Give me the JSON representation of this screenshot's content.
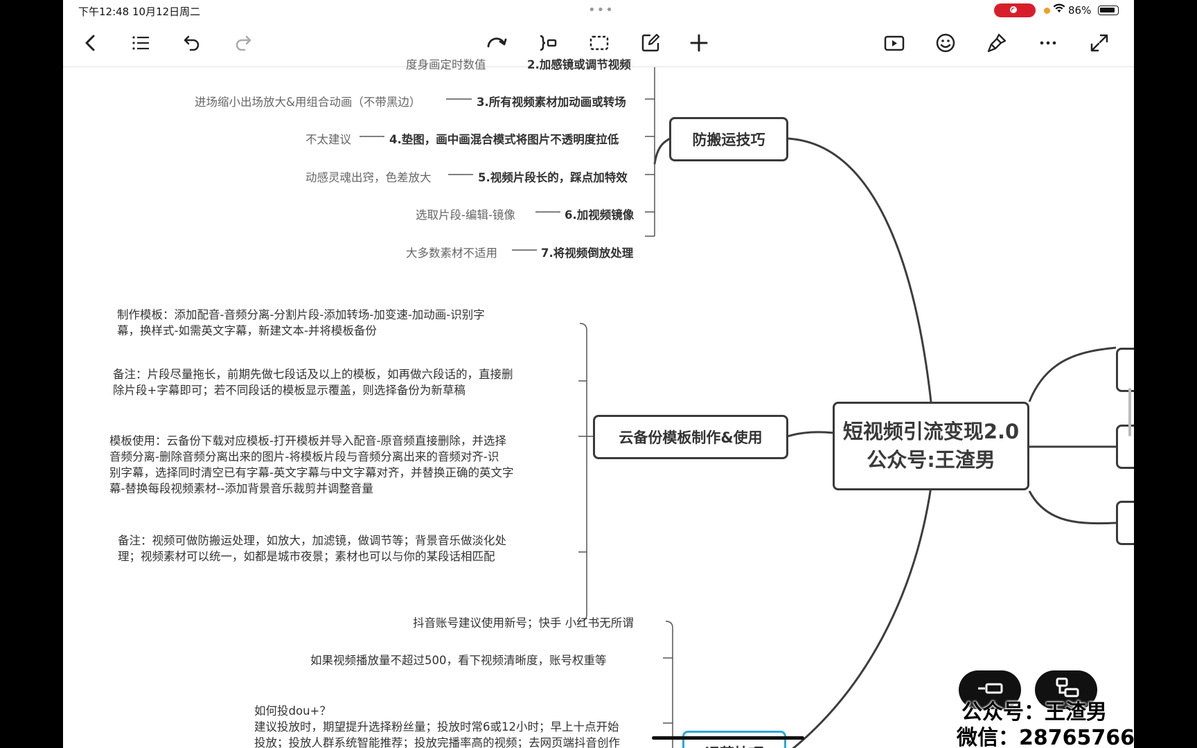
{
  "status_bar": {
    "time": "下午12:48   10月12日周二",
    "battery": "86%"
  },
  "mindmap": {
    "root": {
      "line1": "短视频引流变现2.0",
      "line2": "公众号:王渣男"
    },
    "branch_anti": {
      "label": "防搬运技巧",
      "items": [
        {
          "title": "2.加感镜或调节视频",
          "note": "度身画定时数值"
        },
        {
          "title": "3.所有视频素材加动画或转场",
          "note": "进场缩小出场放大&用组合动画（不带黑边）"
        },
        {
          "title": "4.垫图，画中画混合模式将图片不透明度拉低",
          "note": "不太建议"
        },
        {
          "title": "5.视频片段长的，踩点加特效",
          "note": "动感灵魂出窍，色差放大"
        },
        {
          "title": "6.加视频镜像",
          "note": "选取片段-编辑-镜像"
        },
        {
          "title": "7.将视频倒放处理",
          "note": "大多数素材不适用"
        }
      ]
    },
    "branch_cloud": {
      "label": "云备份模板制作&使用",
      "paras": [
        [
          "制作模板：添加配音-音频分离-分割片段-添加转场-加变速-加动画-识别字",
          "幕，换样式-如需英文字幕，新建文本-并将模板备份"
        ],
        [
          "备注：片段尽量拖长，前期先做七段话及以上的模板，如再做六段话的，直接删",
          "除片段+字幕即可；若不同段话的模板显示覆盖，则选择备份为新草稿"
        ],
        [
          "模板使用：云备份下载对应模板-打开模板并导入配音-原音频直接删除，并选择",
          "音频分离-删除音频分离出来的图片-将模板片段与音频分离出来的音频对齐-识",
          "别字幕，选择同时清空已有字幕-英文字幕与中文字幕对齐，并替换正确的英文字",
          "幕-替换每段视频素材--添加背景音乐裁剪并调整音量"
        ],
        [
          "备注：视频可做防搬运处理，如放大，加滤镜，做调节等；背景音乐做淡化处",
          "理；视频素材可以统一，如都是城市夜景；素材也可以与你的某段话相匹配"
        ]
      ]
    },
    "branch_bottom": {
      "label": "运营技巧",
      "items": [
        "抖音账号建议使用新号；快手 小红书无所谓",
        "如果视频播放量不超过500，看下视频清晰度，账号权重等"
      ],
      "para": [
        "如何投dou+？",
        "建议投放时，期望提升选择粉丝量；投放时常6或12小时；早上十点开始",
        "投放；投放人群系统智能推荐；投放完播率高的视频；去网页端抖音创作"
      ]
    }
  },
  "watermark": {
    "line1": "公众号：王渣男",
    "line2": "微信：28765766"
  }
}
